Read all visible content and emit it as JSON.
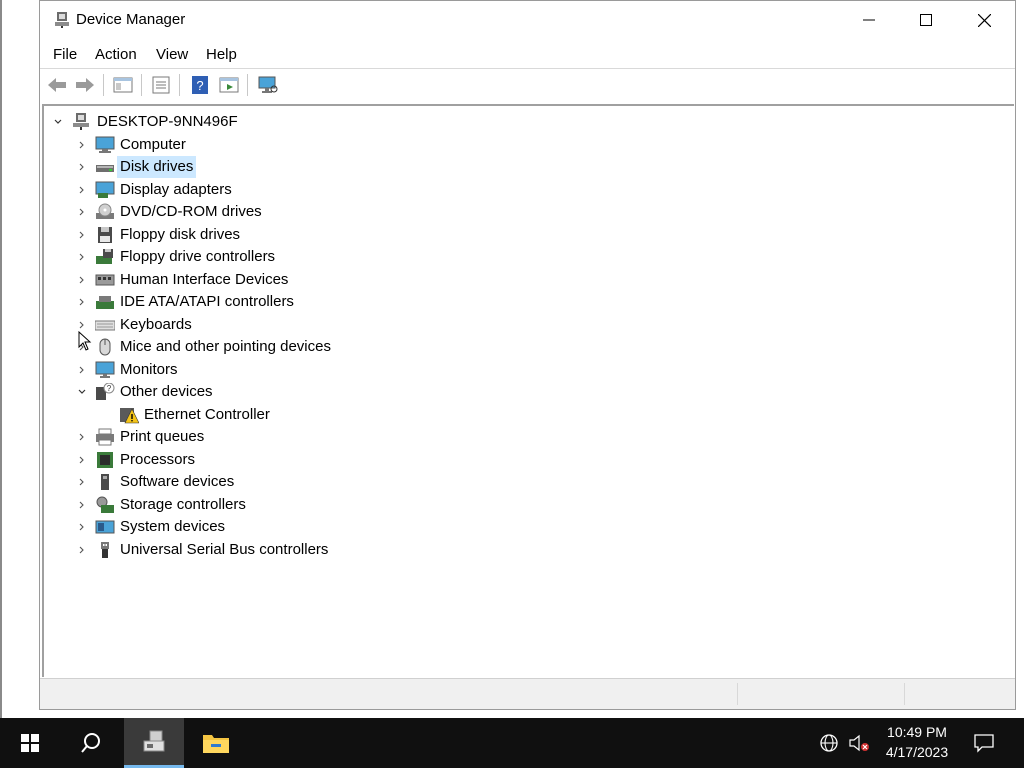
{
  "window": {
    "title": "Device Manager",
    "menu": [
      "File",
      "Action",
      "View",
      "Help"
    ]
  },
  "toolbar": {
    "buttons": [
      "back-icon",
      "forward-icon",
      "show-hide-tree-icon",
      "properties-icon",
      "help-icon",
      "run-icon",
      "scan-hardware-icon"
    ]
  },
  "tree": {
    "root": "DESKTOP-9NN496F",
    "nodes": [
      {
        "label": "Computer",
        "icon": "computer-icon",
        "expanded": false
      },
      {
        "label": "Disk drives",
        "icon": "disk-drive-icon",
        "expanded": false,
        "selected": true
      },
      {
        "label": "Display adapters",
        "icon": "display-adapter-icon",
        "expanded": false
      },
      {
        "label": "DVD/CD-ROM drives",
        "icon": "dvd-icon",
        "expanded": false
      },
      {
        "label": "Floppy disk drives",
        "icon": "floppy-icon",
        "expanded": false
      },
      {
        "label": "Floppy drive controllers",
        "icon": "floppy-controller-icon",
        "expanded": false
      },
      {
        "label": "Human Interface Devices",
        "icon": "hid-icon",
        "expanded": false
      },
      {
        "label": "IDE ATA/ATAPI controllers",
        "icon": "ide-icon",
        "expanded": false
      },
      {
        "label": "Keyboards",
        "icon": "keyboard-icon",
        "expanded": false
      },
      {
        "label": "Mice and other pointing devices",
        "icon": "mouse-icon",
        "expanded": false
      },
      {
        "label": "Monitors",
        "icon": "monitor-icon",
        "expanded": false
      },
      {
        "label": "Other devices",
        "icon": "unknown-device-icon",
        "expanded": true
      },
      {
        "label": "Ethernet Controller",
        "icon": "warning-device-icon",
        "child": true
      },
      {
        "label": "Print queues",
        "icon": "printer-icon",
        "expanded": false
      },
      {
        "label": "Processors",
        "icon": "processor-icon",
        "expanded": false
      },
      {
        "label": "Software devices",
        "icon": "software-device-icon",
        "expanded": false
      },
      {
        "label": "Storage controllers",
        "icon": "storage-controller-icon",
        "expanded": false
      },
      {
        "label": "System devices",
        "icon": "system-device-icon",
        "expanded": false
      },
      {
        "label": "Universal Serial Bus controllers",
        "icon": "usb-icon",
        "expanded": false
      }
    ]
  },
  "taskbar": {
    "time": "10:49 PM",
    "date": "4/17/2023"
  },
  "colors": {
    "selection": "#cce8ff",
    "taskbar": "#101010",
    "active_task_underline": "#76b9ed"
  }
}
